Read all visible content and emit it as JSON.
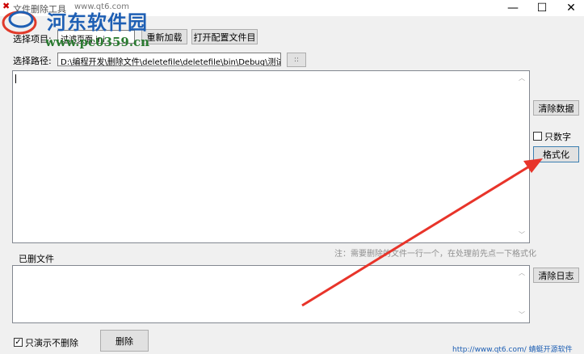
{
  "window": {
    "title": "文件删除工具",
    "minimize_glyph": "—",
    "maximize_glyph": "☐",
    "close_glyph": "✕"
  },
  "watermark": {
    "url_small": "www.qt6.com",
    "brand": "河东软件园",
    "site": "www.pc0359.cn"
  },
  "top_row": {
    "project_label": "选择项目:",
    "project_value": "过滤页面.ini",
    "reload_button": "重新加载",
    "open_config_button": "打开配置文件目"
  },
  "path_row": {
    "label": "选择路径:",
    "value": "D:\\编程开发\\删除文件\\deletefile\\deletefile\\bin\\Debug\\测试",
    "browse_button": "::"
  },
  "right_panel": {
    "clear_data_button": "清除数据",
    "only_numbers_label": "只数字",
    "only_numbers_checked": false,
    "format_button": "格式化"
  },
  "hint_text": "注：需要删除的文件一行一个，在处理前先点一下格式化",
  "deleted_files_label": "已删文件",
  "clear_log_button": "清除日志",
  "bottom": {
    "demo_only_label": "只演示不删除",
    "demo_only_checked": true,
    "delete_button": "删除",
    "footer_link": "http://www.qt6.com/ 蜻蜓开源软件"
  },
  "colors": {
    "annotation_arrow": "#e8342a",
    "watermark_blue": "#1e5fb4"
  }
}
